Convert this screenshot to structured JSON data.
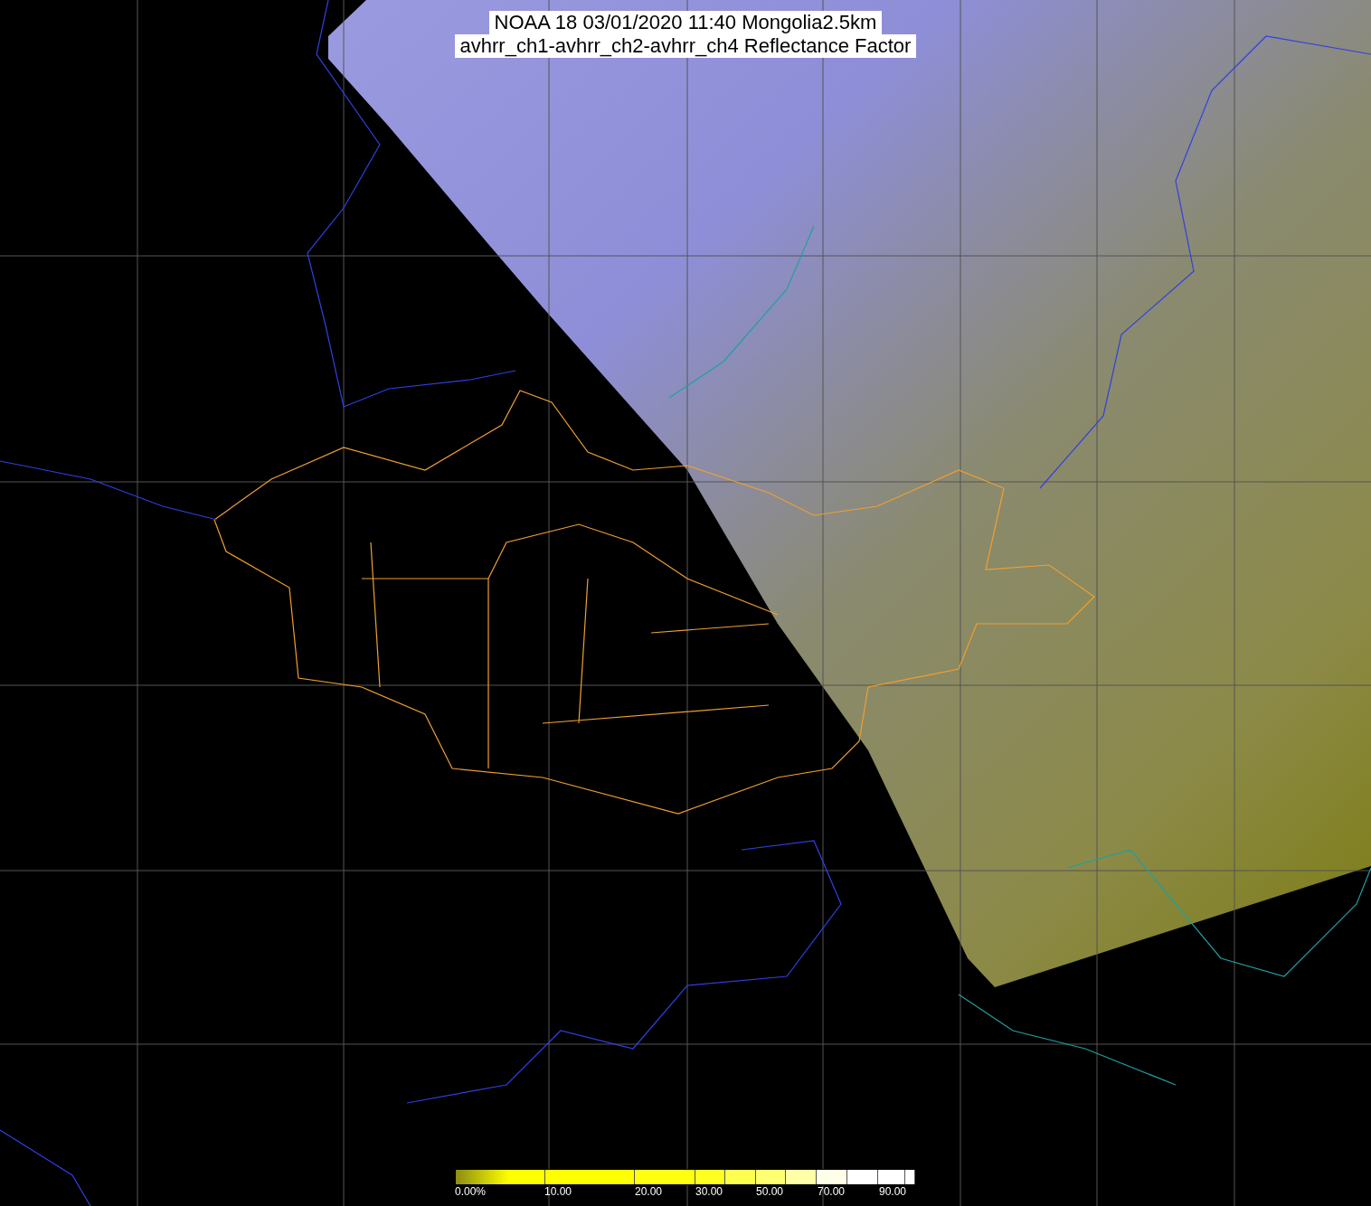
{
  "title": {
    "lines": [
      "NOAA 18 03/01/2020 11:40 Mongolia2.5km",
      "avhrr_ch1-avhrr_ch2-avhrr_ch4 Reflectance Factor"
    ]
  },
  "colorbar": {
    "labels": [
      "0.00%",
      "10.00",
      "20.00",
      "30.00",
      "50.00",
      "70.00",
      "90.00"
    ]
  }
}
